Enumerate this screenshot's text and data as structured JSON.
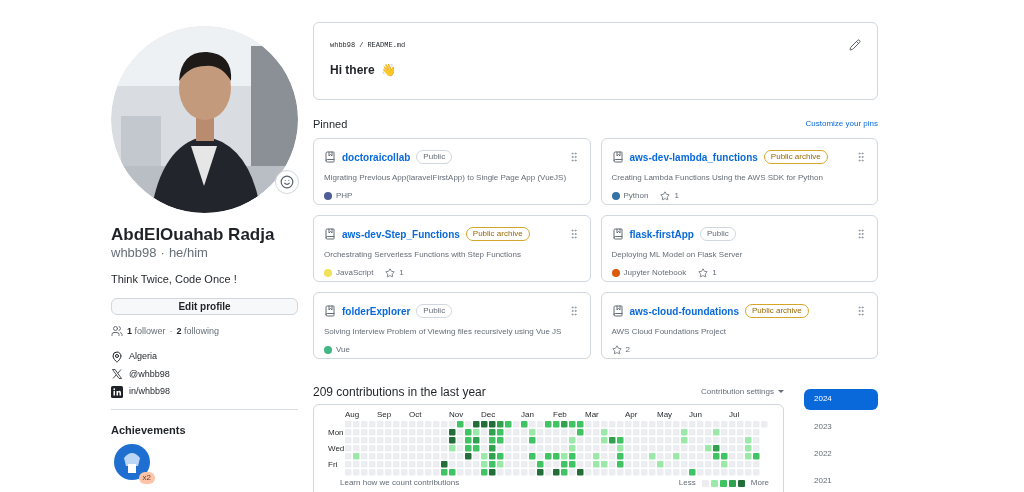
{
  "profile": {
    "name": "AbdElOuahab Radja",
    "handle": "whbb98",
    "handle_separator": "·",
    "pronouns": "he/him",
    "bio": "Think Twice, Code Once !",
    "edit_button": "Edit profile",
    "followers_count": "1",
    "followers_label": "follower",
    "follow_separator": "·",
    "following_count": "2",
    "following_label": "following",
    "location": "Algeria",
    "x_handle": "@whbb98",
    "linkedin": "in/whbb98"
  },
  "achievements": {
    "title": "Achievements",
    "badges": [
      {
        "multiplier": "x2"
      }
    ]
  },
  "readme": {
    "owner": "whbb98",
    "separator": "/",
    "file": "README.md",
    "heading": "Hi there",
    "emoji": "👋"
  },
  "pinned": {
    "title": "Pinned",
    "customize_link": "Customize your pins",
    "repos": [
      {
        "name": "doctoraicollab",
        "visibility": "Public",
        "archived": false,
        "description": "Migrating Previous App(laravelFirstApp) to Single Page App (VueJS)",
        "language": "PHP",
        "color": "#4f5d95"
      },
      {
        "name": "aws-dev-lambda_functions",
        "visibility": "Public archive",
        "archived": true,
        "description": "Creating Lambda Functions Using the AWS SDK for Python",
        "language": "Python",
        "color": "#3572a5",
        "stars_text": "1"
      },
      {
        "name": "aws-dev-Step_Functions",
        "visibility": "Public archive",
        "archived": true,
        "description": "Orchestrating Serverless Functions with Step Functions",
        "language": "JavaScript",
        "color": "#f1e05a",
        "stars_text": "1"
      },
      {
        "name": "flask-firstApp",
        "visibility": "Public",
        "archived": false,
        "description": "Deploying ML Model on Flask Server",
        "language": "Jupyter Notebook",
        "color": "#da5b0b",
        "stars_text": "1"
      },
      {
        "name": "folderExplorer",
        "visibility": "Public",
        "archived": false,
        "description": "Solving Interview Problem of Viewing files recursively using Vue JS",
        "language": "Vue",
        "color": "#41b883"
      },
      {
        "name": "aws-cloud-foundations",
        "visibility": "Public archive",
        "archived": true,
        "description": "AWS Cloud Foundations Project",
        "stars_text": "2"
      }
    ]
  },
  "contributions": {
    "title": "209 contributions in the last year",
    "settings": "Contribution settings",
    "months": [
      "Aug",
      "Sep",
      "Oct",
      "Nov",
      "Dec",
      "Jan",
      "Feb",
      "Mar",
      "Apr",
      "May",
      "Jun",
      "Jul"
    ],
    "day_labels": [
      "Mon",
      "Wed",
      "Fri"
    ],
    "learn_link": "Learn how we count contributions",
    "less": "Less",
    "more": "More"
  },
  "years": [
    {
      "label": "2024",
      "selected": true
    },
    {
      "label": "2023",
      "selected": false
    },
    {
      "label": "2022",
      "selected": false
    },
    {
      "label": "2021",
      "selected": false
    }
  ]
}
